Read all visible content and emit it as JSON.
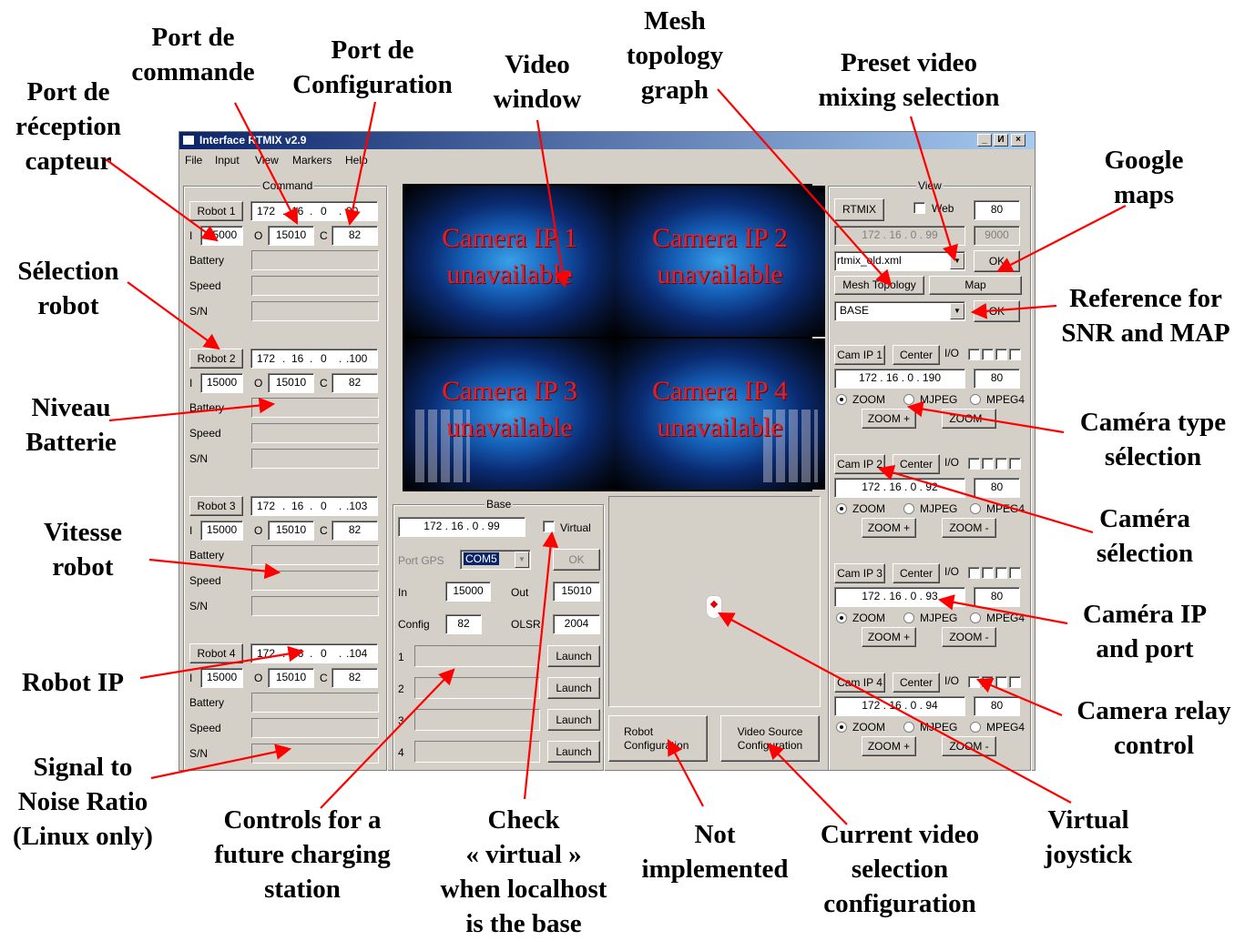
{
  "window": {
    "title": "Interface RTMIX v2.9",
    "controls": [
      "_",
      "И",
      "×"
    ],
    "menu": [
      "File",
      "Input",
      "View",
      "Markers",
      "Help"
    ]
  },
  "command": {
    "legend": "Command",
    "labels": {
      "in": "I",
      "out": "O",
      "config": "C",
      "battery": "Battery",
      "speed": "Speed",
      "sn": "S/N"
    },
    "robots": [
      {
        "button": "Robot 1",
        "ip": [
          "172",
          "16",
          "0",
          "90"
        ],
        "in": "15000",
        "out": "15010",
        "config": "82"
      },
      {
        "button": "Robot 2",
        "ip": [
          "172",
          "16",
          "0",
          ".100"
        ],
        "in": "15000",
        "out": "15010",
        "config": "82"
      },
      {
        "button": "Robot 3",
        "ip": [
          "172",
          "16",
          "0",
          ".103"
        ],
        "in": "15000",
        "out": "15010",
        "config": "82"
      },
      {
        "button": "Robot 4",
        "ip": [
          "172",
          "16",
          "0",
          ".104"
        ],
        "in": "15000",
        "out": "15010",
        "config": "82"
      }
    ]
  },
  "video": {
    "cameras": [
      {
        "line1": "Camera IP 1",
        "line2": "unavailable"
      },
      {
        "line1": "Camera IP 2",
        "line2": "unavailable"
      },
      {
        "line1": "Camera IP 3",
        "line2": "unavailable"
      },
      {
        "line1": "Camera IP 4",
        "line2": "unavailable"
      }
    ]
  },
  "base": {
    "legend": "Base",
    "ip": "172 . 16 . 0 . 99",
    "virtual_label": "Virtual",
    "port_gps_label": "Port GPS",
    "port_gps_value": "COM5",
    "ok_label": "OK",
    "in_label": "In",
    "in_value": "15000",
    "out_label": "Out",
    "out_value": "15010",
    "config_label": "Config",
    "config_value": "82",
    "olsr_label": "OLSR",
    "olsr_value": "2004",
    "slots": [
      {
        "num": "1",
        "button": "Launch"
      },
      {
        "num": "2",
        "button": "Launch"
      },
      {
        "num": "3",
        "button": "Launch"
      },
      {
        "num": "4",
        "button": "Launch"
      }
    ]
  },
  "bottom_buttons": {
    "robot_config": "Robot\nConfiguration",
    "video_source_config": "Video Source\nConfiguration"
  },
  "view": {
    "legend": "View",
    "rtmix_button": "RTMIX",
    "web_label": "Web",
    "port_value": "80",
    "ip_disabled": "172 . 16 . 0 . 99",
    "port_disabled": "9000",
    "preset_value": "rtmix_old.xml",
    "ok_label": "OK",
    "mesh_button": "Mesh Topology",
    "map_button": "Map",
    "reference_value": "BASE",
    "ok2_label": "OK",
    "io_label": "I/O",
    "center_label": "Center",
    "zoom_in": "ZOOM +",
    "zoom_out": "ZOOM -",
    "radio_labels": [
      "ZOOM",
      "MJPEG",
      "MPEG4"
    ],
    "cams": [
      {
        "button": "Cam IP 1",
        "ip": "172 . 16 . 0 . 190",
        "port": "80"
      },
      {
        "button": "Cam IP 2",
        "ip": "172 . 16 . 0 . 92",
        "port": "80"
      },
      {
        "button": "Cam IP 3",
        "ip": "172 . 16 . 0 . 93",
        "port": "80"
      },
      {
        "button": "Cam IP 4",
        "ip": "172 . 16 . 0 . 94",
        "port": "80"
      }
    ]
  },
  "annotations": {
    "port_reception": "Port de\nréception\ncapteur",
    "port_commande": "Port de\ncommande",
    "port_configuration": "Port de\nConfiguration",
    "video_window": "Video\nwindow",
    "mesh_topology": "Mesh\ntopology\ngraph",
    "preset_video": "Preset video\nmixing selection",
    "google_maps": "Google\nmaps",
    "selection_robot": "Sélection\nrobot",
    "reference_snr": "Reference for\nSNR and MAP",
    "niveau_batterie": "Niveau\nBatterie",
    "camera_type": "Caméra type\nsélection",
    "vitesse_robot": "Vitesse\nrobot",
    "camera_selection": "Caméra\nsélection",
    "camera_ip_port": "Caméra IP\nand port",
    "robot_ip": "Robot IP",
    "camera_relay": "Camera relay\ncontrol",
    "signal_noise": "Signal to\nNoise Ratio\n(Linux only)",
    "charging_station": "Controls for a\nfuture charging\nstation",
    "check_virtual": "Check\n« virtual »\nwhen localhost\nis the base",
    "not_implemented": "Not\nimplemented",
    "current_video": "Current video\nselection\nconfiguration",
    "virtual_joystick": "Virtual\njoystick"
  },
  "colors": {
    "arrow": "#ff0000",
    "title_gradient_start": "#0a246a",
    "window_bg": "#d4d0c8",
    "camera_text": "#e0202a"
  }
}
